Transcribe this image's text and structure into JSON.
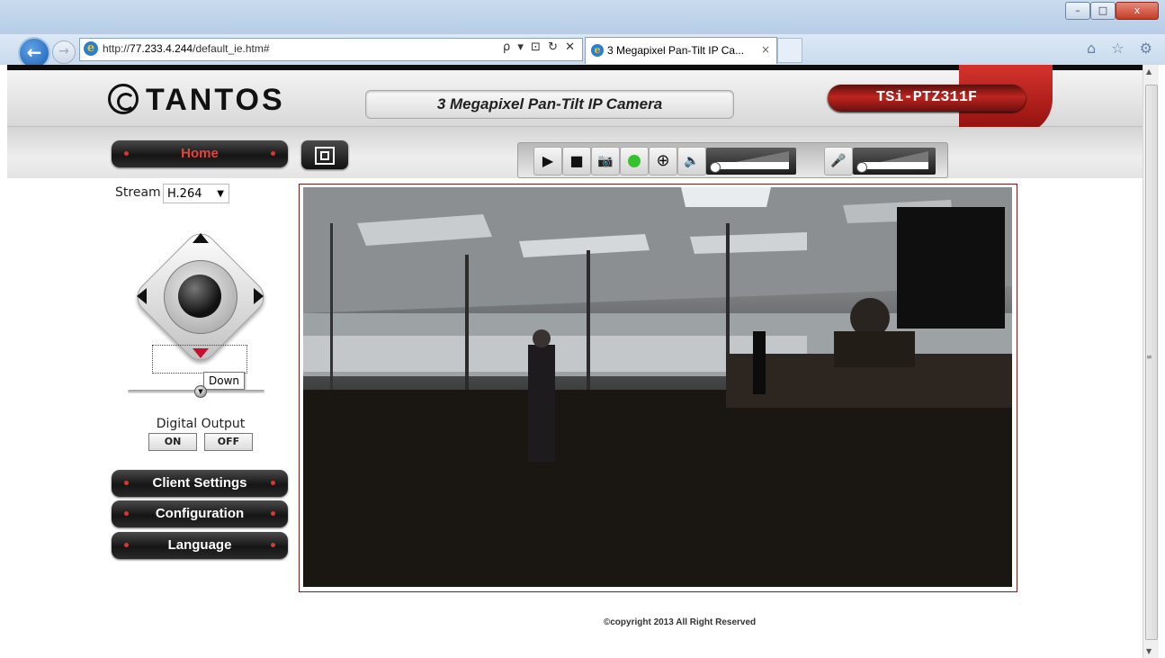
{
  "browser": {
    "address_url_prefix": "http://",
    "address_url_host": "77.233.4.244",
    "address_url_path": "/default_ie.htm#",
    "address_tools": "ρ ▾ ⊡ ↻ ✕",
    "tab_title": "3 Megapixel Pan-Tilt IP Ca...",
    "tab_close": "×",
    "min_label": "–",
    "max_label": "□",
    "close_label": "x",
    "back_glyph": "←",
    "forward_glyph": "→",
    "right_icons": "⌂ ☆ ⚙"
  },
  "header": {
    "brand": "TANTOS",
    "camera_title": "3 Megapixel Pan-Tilt IP Camera",
    "model": "TSi-PTZ311F"
  },
  "nav": {
    "home_label": "Home"
  },
  "controls": {
    "play_icon": "▶",
    "stop_icon": "■",
    "snapshot_icon": "📷",
    "status_color": "#34c22d",
    "zoom_icon": "⊕",
    "volume_icon": "🔈",
    "mic_icon": "🎤"
  },
  "stream": {
    "label": "Stream",
    "value": "H.264",
    "arrow": "▼"
  },
  "ptz": {
    "tooltip": "Down",
    "zoom_knob": "▼"
  },
  "digital_output": {
    "label": "Digital Output",
    "on_label": "ON",
    "off_label": "OFF"
  },
  "menu": {
    "client_settings": "Client Settings",
    "configuration": "Configuration",
    "language": "Language"
  },
  "footer": {
    "copyright": "©copyright 2013 All Right Reserved"
  },
  "scrollbar": {
    "up": "▲",
    "down": "▼",
    "grip": "≡"
  }
}
